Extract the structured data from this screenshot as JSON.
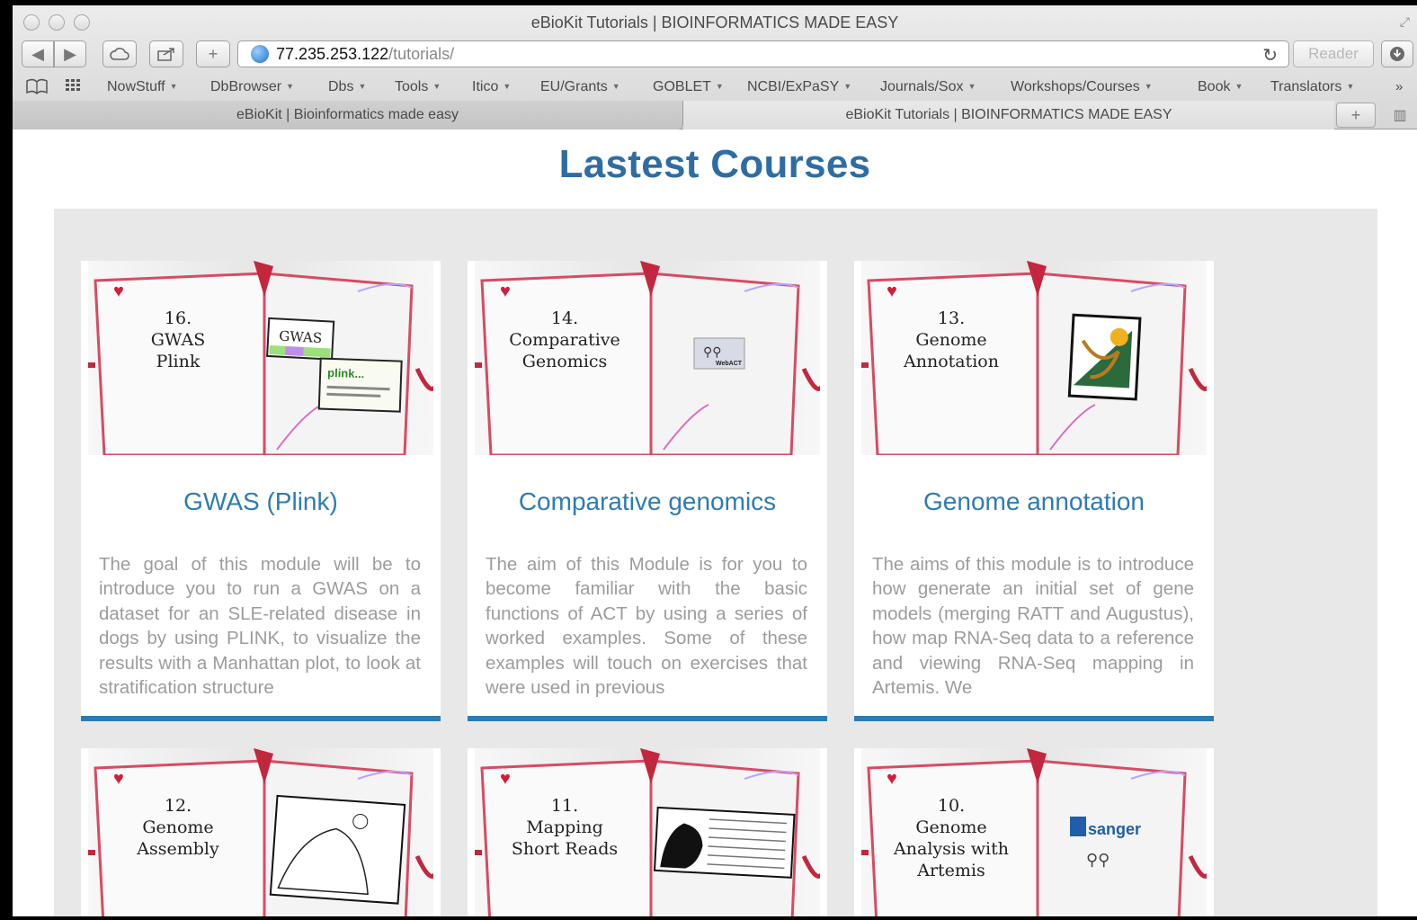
{
  "window": {
    "title": "eBioKit Tutorials | BIOINFORMATICS MADE EASY"
  },
  "toolbar": {
    "url_host": "77.235.253.122",
    "url_path": "/tutorials/",
    "reader_label": "Reader"
  },
  "bookmarks": [
    {
      "label": "NowStuff",
      "dropdown": true
    },
    {
      "label": "DbBrowser",
      "dropdown": true
    },
    {
      "label": "Dbs",
      "dropdown": true
    },
    {
      "label": "Tools",
      "dropdown": true
    },
    {
      "label": "Itico",
      "dropdown": true
    },
    {
      "label": "EU/Grants",
      "dropdown": true
    },
    {
      "label": "GOBLET",
      "dropdown": true
    },
    {
      "label": "NCBI/ExPaSY",
      "dropdown": true
    },
    {
      "label": "Journals/Sox",
      "dropdown": true
    },
    {
      "label": "Workshops/Courses",
      "dropdown": true
    },
    {
      "label": "Book",
      "dropdown": true
    },
    {
      "label": "Translators",
      "dropdown": true
    }
  ],
  "tabs": [
    {
      "label": "eBioKit | Bioinformatics made easy",
      "active": false
    },
    {
      "label": "eBioKit Tutorials | BIOINFORMATICS MADE EASY",
      "active": true
    }
  ],
  "page": {
    "heading": "Lastest Courses",
    "accent_color": "#2e7bb4",
    "courses": [
      {
        "notebook_number": "16.",
        "notebook_lines": [
          "GWAS",
          "Plink"
        ],
        "image_labels": [
          "GWAS",
          "plink..."
        ],
        "title": "GWAS (Plink)",
        "description": "The goal of this module will be to introduce you to run a GWAS on a dataset for an SLE-related disease in dogs by using PLINK, to visualize the results with a Manhattan plot, to look at stratification structure"
      },
      {
        "notebook_number": "14.",
        "notebook_lines": [
          "Comparative",
          "Genomics"
        ],
        "image_labels": [
          "WebACT"
        ],
        "title": "Comparative genomics",
        "description": "The aim of this Module is for you to become familiar with the basic functions of ACT by using a series of worked examples. Some of these examples will touch on exercises that were used in previous"
      },
      {
        "notebook_number": "13.",
        "notebook_lines": [
          "Genome",
          "Annotation"
        ],
        "image_labels": [],
        "title": "Genome annotation",
        "description": "The aims of this module is to introduce how generate an initial set of gene models (merging RATT and Augustus), how map RNA-Seq data to a reference and viewing RNA-Seq mapping in Artemis. We"
      },
      {
        "notebook_number": "12.",
        "notebook_lines": [
          "Genome",
          "Assembly"
        ],
        "image_labels": [],
        "title": "",
        "description": ""
      },
      {
        "notebook_number": "11.",
        "notebook_lines": [
          "Mapping",
          "Short Reads"
        ],
        "image_labels": [],
        "title": "",
        "description": ""
      },
      {
        "notebook_number": "10.",
        "notebook_lines": [
          "Genome",
          "Analysis with",
          "Artemis"
        ],
        "image_labels": [
          "sanger"
        ],
        "title": "",
        "description": ""
      }
    ]
  }
}
